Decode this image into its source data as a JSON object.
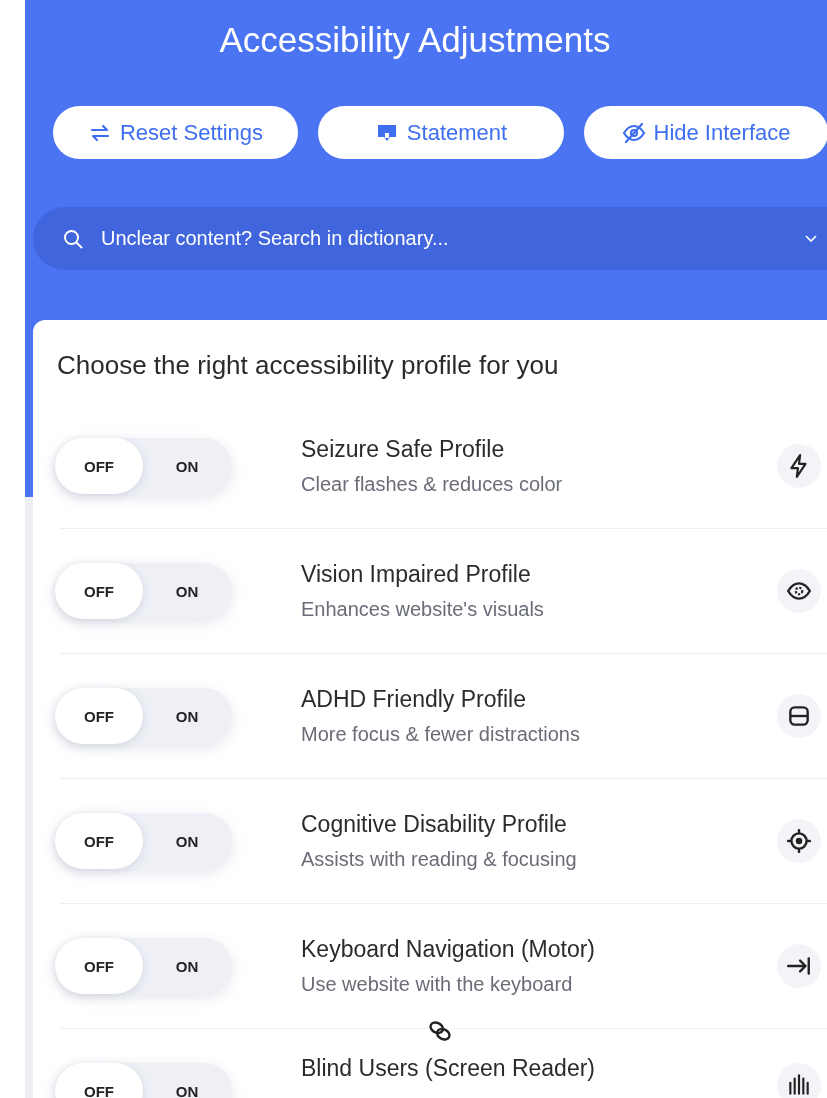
{
  "header": {
    "title": "Accessibility Adjustments"
  },
  "buttons": [
    {
      "label": "Reset Settings"
    },
    {
      "label": "Statement"
    },
    {
      "label": "Hide Interface"
    }
  ],
  "search": {
    "placeholder": "Unclear content? Search in dictionary..."
  },
  "profiles_heading": "Choose the right accessibility profile for you",
  "profiles": [
    {
      "off_label": "OFF",
      "on_label": "ON",
      "title": "Seizure Safe Profile",
      "subtitle": "Clear flashes & reduces color",
      "on": false
    },
    {
      "off_label": "OFF",
      "on_label": "ON",
      "title": "Vision Impaired Profile",
      "subtitle": "Enhances website's visuals",
      "on": false
    },
    {
      "off_label": "OFF",
      "on_label": "ON",
      "title": "ADHD Friendly Profile",
      "subtitle": "More focus & fewer distractions",
      "on": false
    },
    {
      "off_label": "OFF",
      "on_label": "ON",
      "title": "Cognitive Disability Profile",
      "subtitle": "Assists with reading & focusing",
      "on": false
    },
    {
      "off_label": "OFF",
      "on_label": "ON",
      "title": "Keyboard Navigation (Motor)",
      "subtitle": "Use website with the keyboard",
      "on": false
    },
    {
      "off_label": "OFF",
      "on_label": "ON",
      "title": "Blind Users (Screen Reader)",
      "on": false
    }
  ]
}
